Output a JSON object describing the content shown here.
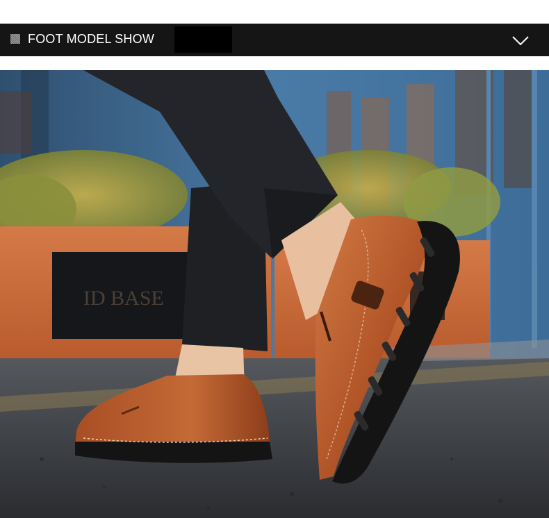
{
  "section_header": {
    "title": "FOOT MODEL SHOW",
    "square_icon": "hatched-square-icon",
    "toggle_icon": "chevron-down-icon"
  },
  "photo": {
    "subject": "foot-model-photo",
    "storefront_sign": "ID BASE"
  },
  "colors": {
    "header_bg": "#151515",
    "header_text": "#ffffff",
    "shoe_leather": "#b4582a",
    "shoe_sole": "#141414",
    "pants": "#1f2024",
    "road": "#34363a",
    "planter": "#c9693a",
    "wall": "#3e6a93"
  }
}
